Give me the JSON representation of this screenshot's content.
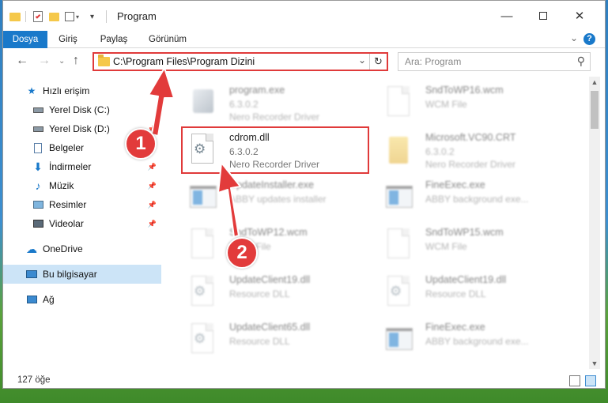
{
  "window": {
    "title": "Program"
  },
  "ribbon": {
    "tabs": [
      "Dosya",
      "Giriş",
      "Paylaş",
      "Görünüm"
    ]
  },
  "nav": {
    "address": "C:\\Program Files\\Program Dizini",
    "search_placeholder": "Ara: Program"
  },
  "sidebar": {
    "items": [
      {
        "label": "Hızlı erişim",
        "icon": "star-icon"
      },
      {
        "label": "Yerel Disk (C:)",
        "icon": "drive-icon"
      },
      {
        "label": "Yerel Disk (D:)",
        "icon": "drive-icon"
      },
      {
        "label": "Belgeler",
        "icon": "documents-icon"
      },
      {
        "label": "İndirmeler",
        "icon": "download-icon"
      },
      {
        "label": "Müzik",
        "icon": "music-icon"
      },
      {
        "label": "Resimler",
        "icon": "pictures-icon"
      },
      {
        "label": "Videolar",
        "icon": "video-icon"
      },
      {
        "label": "OneDrive",
        "icon": "cloud-icon"
      },
      {
        "label": "Bu bilgisayar",
        "icon": "computer-icon"
      },
      {
        "label": "Ağ",
        "icon": "network-icon"
      }
    ]
  },
  "files": [
    {
      "name": "program.exe",
      "version": "6.3.0.2",
      "desc": "Nero Recorder Driver",
      "icon": "exe-icon"
    },
    {
      "name": "SndToWP16.wcm",
      "version": "",
      "desc": "WCM File",
      "icon": "document-icon"
    },
    {
      "name": "cdrom.dll",
      "version": "6.3.0.2",
      "desc": "Nero Recorder Driver",
      "icon": "dll-gear-icon"
    },
    {
      "name": "Microsoft.VC90.CRT",
      "version": "6.3.0.2",
      "desc": "Nero Recorder Driver",
      "icon": "folder-icon"
    },
    {
      "name": "UpdateInstaller.exe",
      "version": "",
      "desc": "ABBY updates installer",
      "icon": "app-window-icon"
    },
    {
      "name": "FineExec.exe",
      "version": "",
      "desc": "ABBY background exe...",
      "icon": "app-window-icon"
    },
    {
      "name": "SndToWP12.wcm",
      "version": "",
      "desc": "WCM File",
      "icon": "document-icon"
    },
    {
      "name": "SndToWP15.wcm",
      "version": "",
      "desc": "WCM File",
      "icon": "document-icon"
    },
    {
      "name": "UpdateClient19.dll",
      "version": "",
      "desc": "Resource DLL",
      "icon": "dll-gear-icon"
    },
    {
      "name": "UpdateClient19.dll",
      "version": "",
      "desc": "Resource DLL",
      "icon": "dll-gear-icon"
    },
    {
      "name": "UpdateClient65.dll",
      "version": "",
      "desc": "Resource DLL",
      "icon": "dll-gear-icon"
    },
    {
      "name": "FineExec.exe",
      "version": "",
      "desc": "ABBY background exe...",
      "icon": "app-window-icon"
    }
  ],
  "status": {
    "count": "127 öğe"
  },
  "annotations": {
    "badge1": "1",
    "badge2": "2"
  },
  "colors": {
    "accent": "#1979ca",
    "highlight": "#e03a3a"
  }
}
